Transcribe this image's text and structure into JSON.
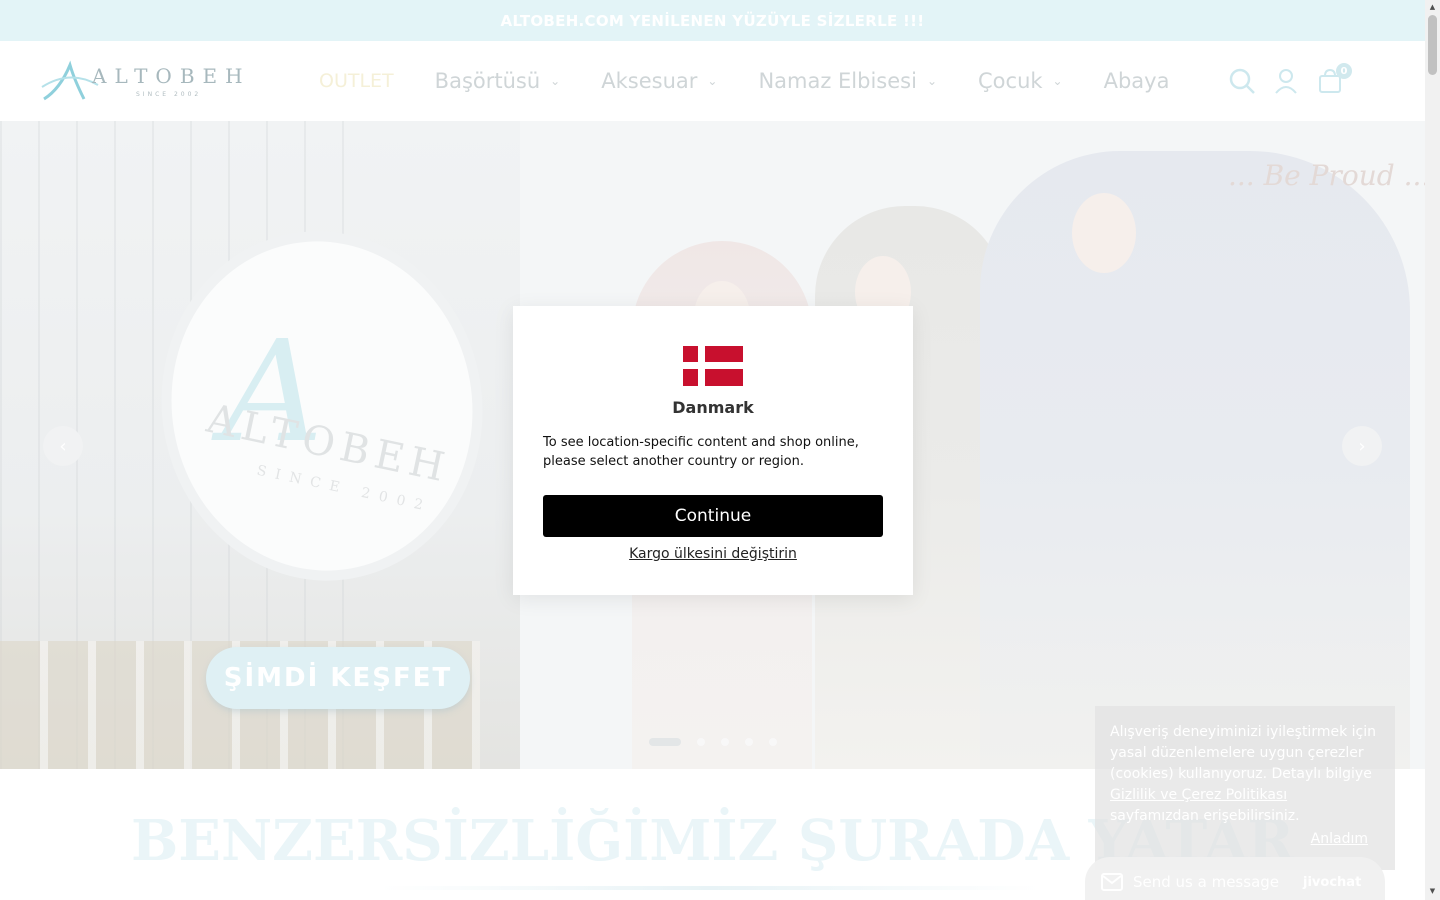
{
  "announcement": {
    "text": "ALTOBEH.COM YENİLENEN YÜZÜYLE SİZLERLE !!!"
  },
  "header": {
    "logo_text": "ALTOBEH",
    "logo_sub": "SINCE 2002",
    "nav": [
      {
        "label": "OUTLET",
        "has_dropdown": false
      },
      {
        "label": "Başörtüsü",
        "has_dropdown": true
      },
      {
        "label": "Aksesuar",
        "has_dropdown": true
      },
      {
        "label": "Namaz Elbisesi",
        "has_dropdown": true
      },
      {
        "label": "Çocuk",
        "has_dropdown": true
      },
      {
        "label": "Abaya",
        "has_dropdown": false
      }
    ],
    "icons": [
      "search-icon",
      "account-icon",
      "cart-icon"
    ],
    "cart_count": "0"
  },
  "hero": {
    "tagline": "... Be Proud ...",
    "sign_word": "ALTOBEH",
    "sign_since": "SINCE 2002",
    "cta_label": "ŞİMDİ KEŞFET",
    "slide_count": 5,
    "active_slide": 1
  },
  "section": {
    "title": "BENZERSİZLİĞİMİZ ŞURADA YATAR"
  },
  "modal": {
    "country": "Danmark",
    "message": "To see location-specific content and shop online, please select another country or region.",
    "continue_label": "Continue",
    "change_link": "Kargo ülkesini değiştirin",
    "flag_colors": {
      "red": "#c8102e",
      "white": "#ffffff"
    }
  },
  "cookie": {
    "text_before": "Alışveriş deneyiminizi iyileştirmek için yasal düzenlemelere uygun çerezler (cookies) kullanıyoruz. Detaylı bilgiye ",
    "link": "Gizlilik ve Çerez Politikası",
    "text_after": " sayfamızdan erişebilirsiniz.",
    "accept_label": "Anladım"
  },
  "chat": {
    "label": "Send us a message",
    "brand": "jivochat"
  },
  "colors": {
    "accent": "#8fd0dc",
    "button": "#000000"
  }
}
